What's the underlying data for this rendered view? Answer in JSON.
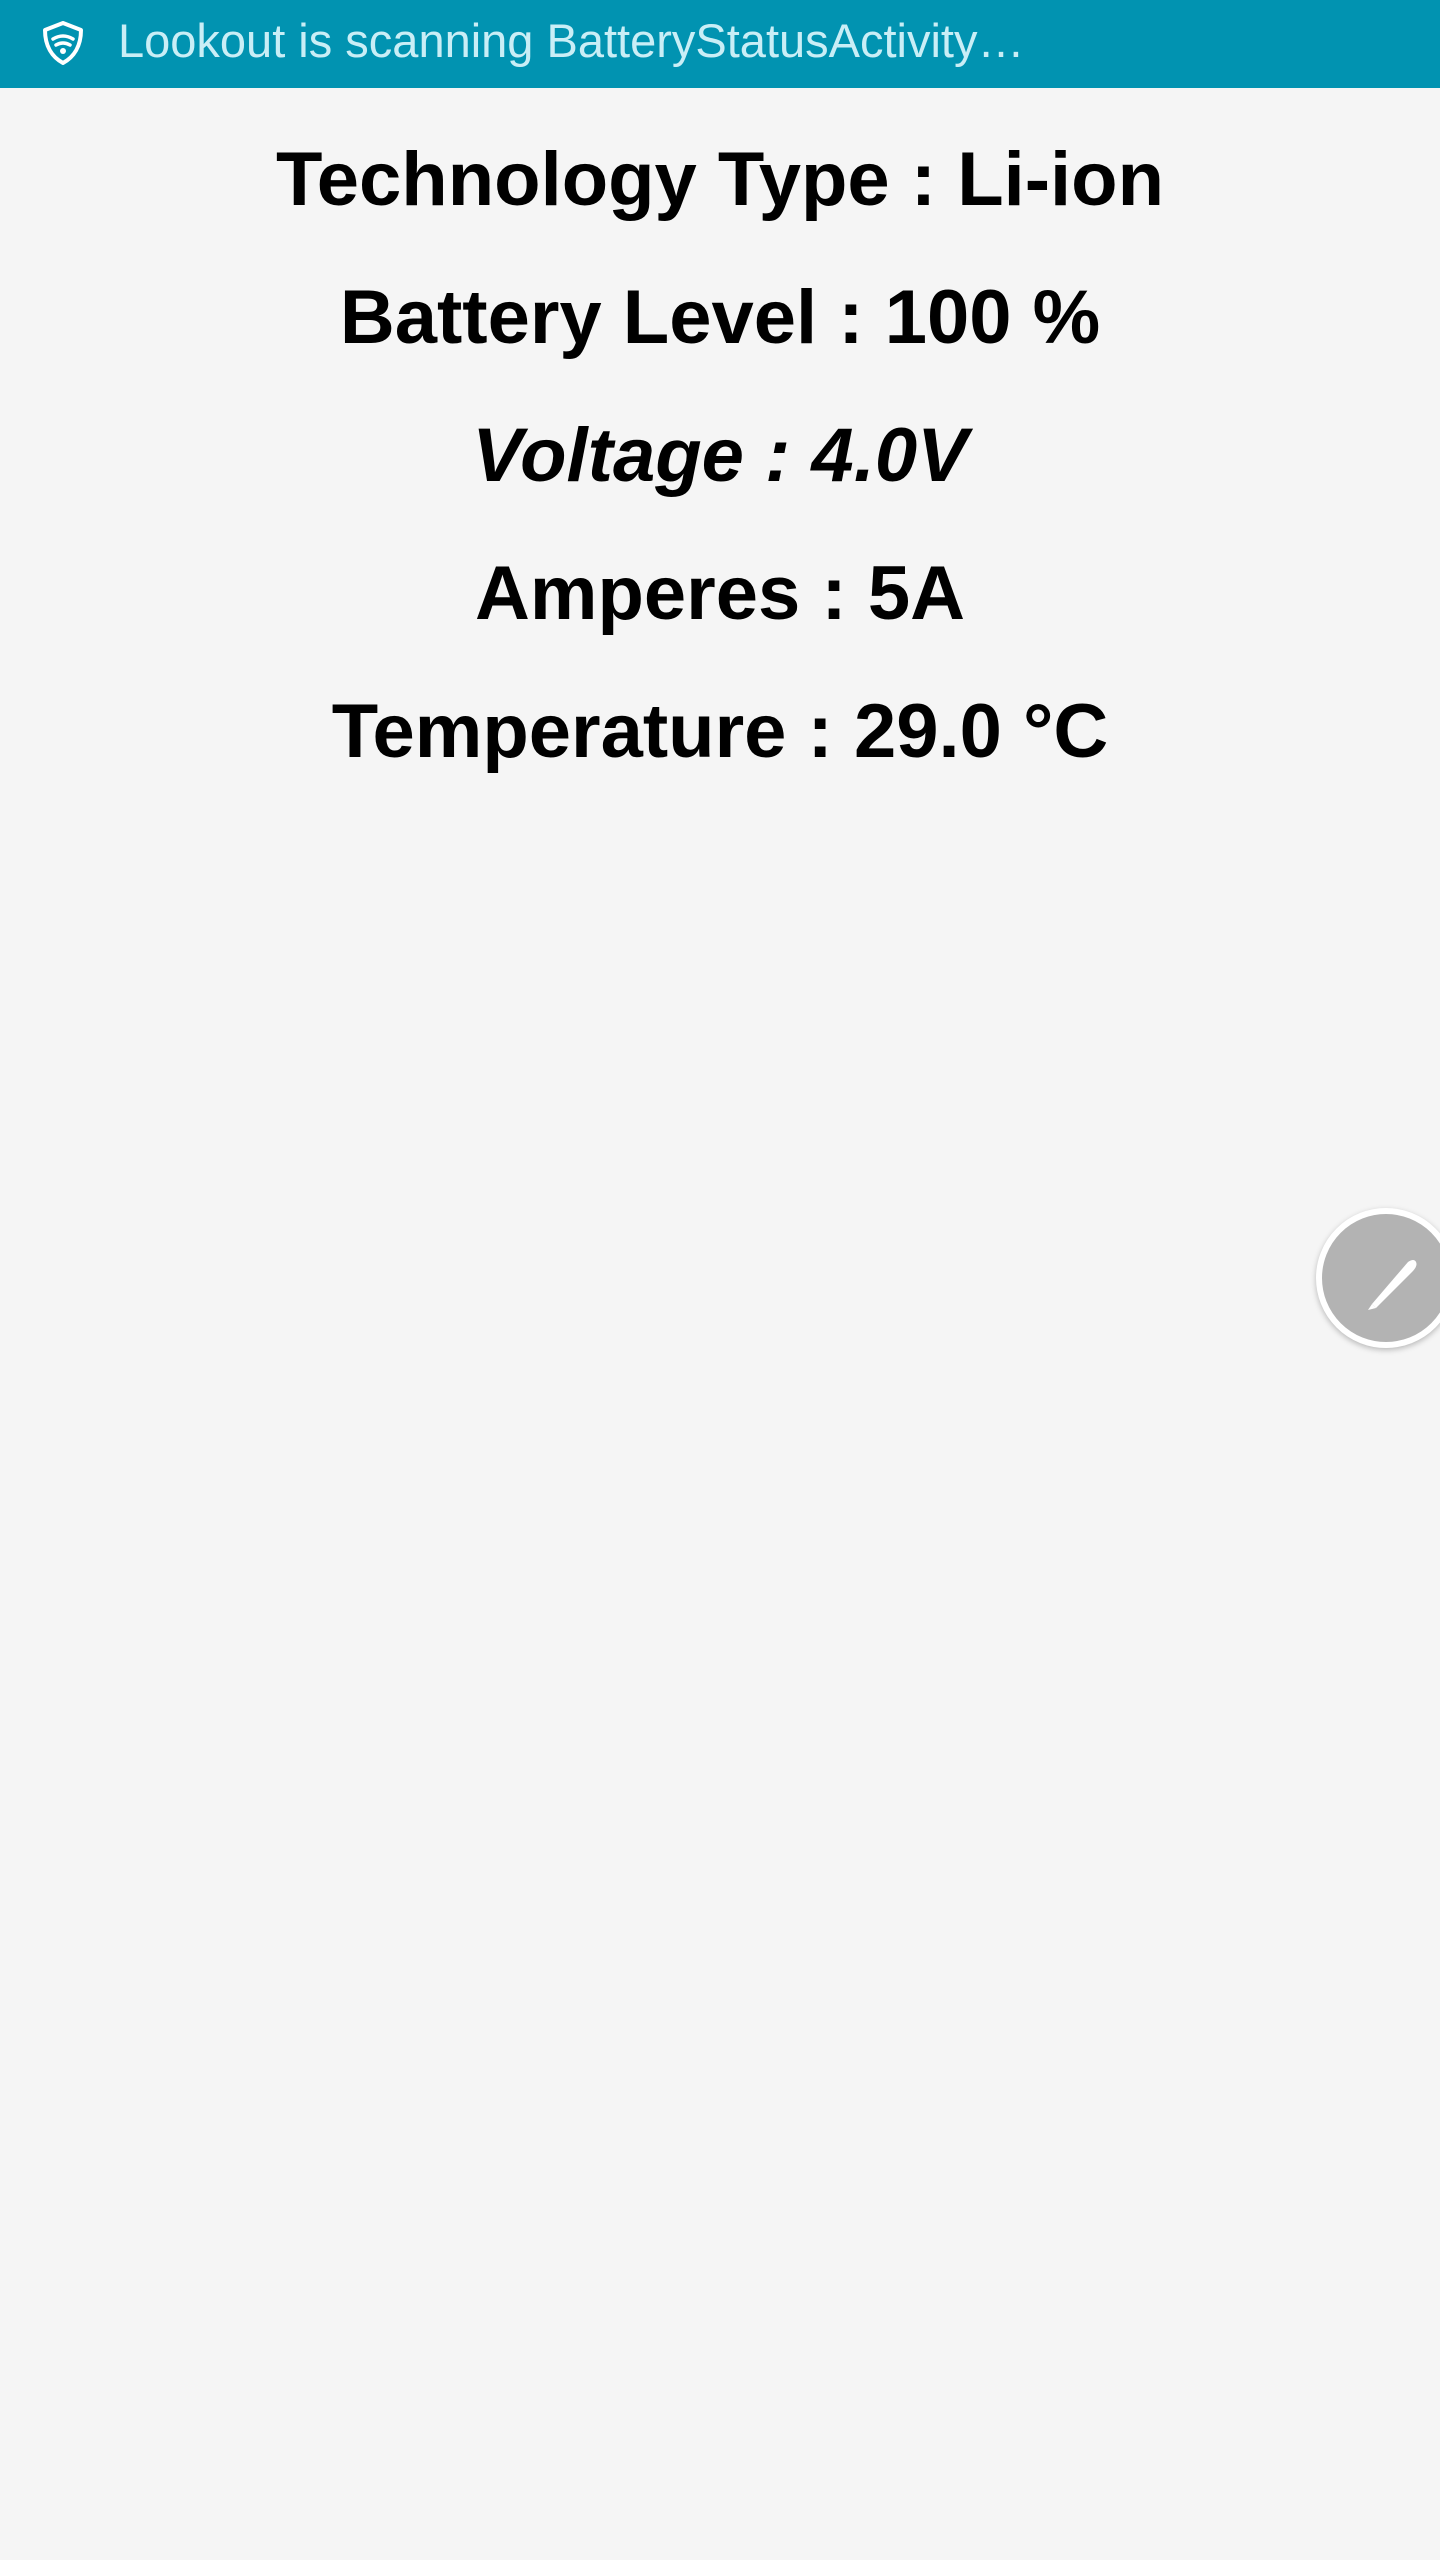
{
  "status_bar": {
    "text": "Lookout is scanning BatteryStatusActivity…",
    "icon": "lookout-shield-icon",
    "background_color": "#0193b1",
    "text_color": "#c9eef6"
  },
  "battery_info": {
    "technology": "Technology Type : Li-ion",
    "level": "Battery Level : 100 %",
    "voltage": "Voltage : 4.0V",
    "amperes": "Amperes : 5A",
    "temperature": "Temperature : 29.0 °C"
  },
  "floating_button": {
    "icon": "pencil-icon",
    "color": "#b3b3b3"
  }
}
